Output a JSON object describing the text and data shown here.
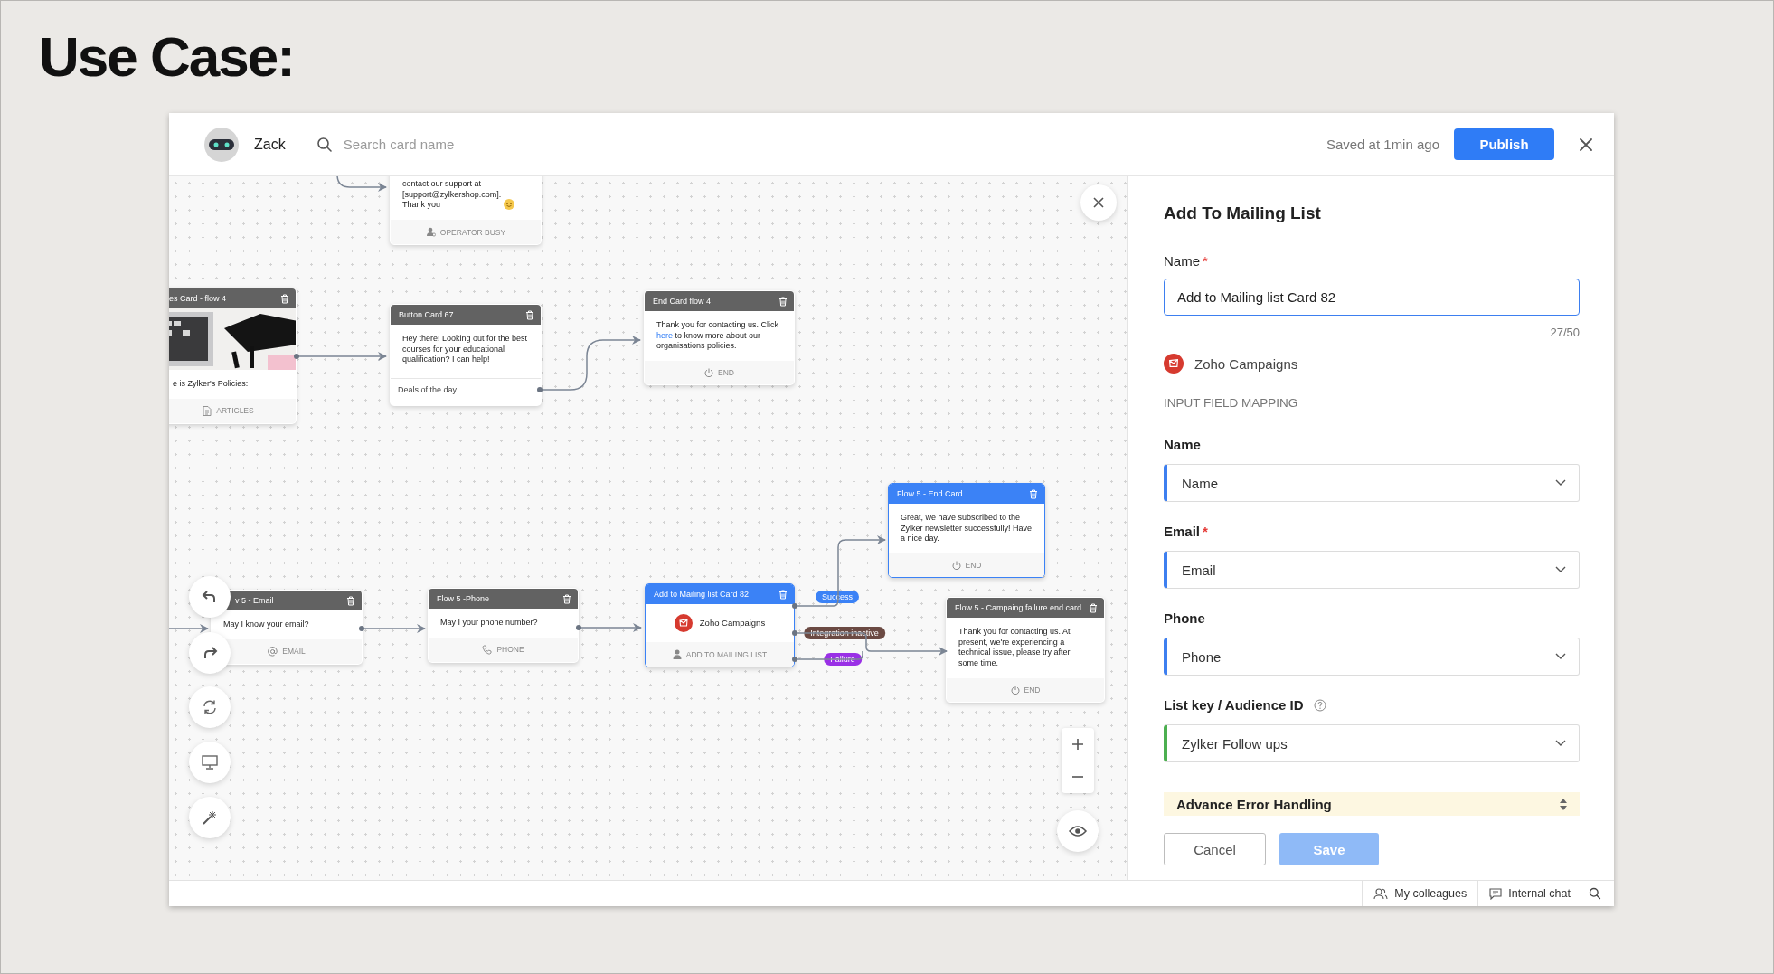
{
  "page_title": "Use Case:",
  "header": {
    "bot_name": "Zack",
    "search": {
      "placeholder": "Search card name"
    },
    "save_status": "Saved at 1min ago",
    "publish_button": "Publish"
  },
  "canvas": {
    "cards": [
      {
        "kind": "busy",
        "body": "contact our support at\n[support@zylkershop.com].\nThank you",
        "footer": {
          "kind": "operator",
          "label": "OPERATOR BUSY"
        },
        "highlighted": false
      },
      {
        "kind": "articles",
        "title": "es Card - flow 4",
        "body": "e is Zylker's Policies:",
        "footer": {
          "kind": "document",
          "label": "ARTICLES"
        },
        "highlighted": false
      },
      {
        "kind": "buttons",
        "title": "Button Card 67",
        "body": "Hey there! Looking out for the best courses for your educational qualification? I can help!",
        "option": "Deals of the day",
        "highlighted": false
      },
      {
        "kind": "message",
        "title": "End Card flow 4",
        "body": "Thank you for contacting us. Click ",
        "link": "here",
        "body_after": " to know more about our organisations policies.",
        "footer": {
          "kind": "end",
          "label": "END"
        },
        "highlighted": false
      },
      {
        "kind": "message",
        "title": "v 5 - Email",
        "body": "May I know your email?",
        "footer": {
          "kind": "email",
          "label": "EMAIL"
        },
        "highlighted": false
      },
      {
        "kind": "message",
        "title": "Flow 5 -Phone",
        "body": "May I your phone number?",
        "footer": {
          "kind": "phone",
          "label": "PHONE"
        },
        "highlighted": false
      },
      {
        "kind": "integration",
        "title": "Add to Mailing list Card 82",
        "service": "Zoho Campaigns",
        "footer": {
          "kind": "contact",
          "label": "ADD TO MAILING LIST"
        },
        "highlighted": true
      },
      {
        "kind": "message",
        "title": "Flow 5 - End Card",
        "body": "Great, we have subscribed to the Zylker newsletter successfully! Have a nice day.",
        "footer": {
          "kind": "end",
          "label": "END"
        },
        "highlighted": true
      },
      {
        "kind": "message",
        "title": "Flow 5 - Campaing failure end card",
        "body": "Thank you for contacting us. At present, we're experiencing a technical issue, please try after some time.",
        "footer": {
          "kind": "end",
          "label": "END"
        },
        "highlighted": false
      }
    ],
    "edge_labels": [
      {
        "text": "Success",
        "color": "#3b82f6"
      },
      {
        "text": "Integration inactive",
        "color": "#6b4a43"
      },
      {
        "text": "Failure",
        "color": "#9a30e6"
      }
    ]
  },
  "panel": {
    "title": "Add To Mailing List",
    "name_field": {
      "label": "Name",
      "required_mark": "*",
      "value": "Add to Mailing list Card 82",
      "counter": "27/50"
    },
    "integration": "Zoho Campaigns",
    "section_label": "INPUT FIELD MAPPING",
    "mappings": [
      {
        "label": "Name",
        "value": "Name",
        "help": false,
        "color": "#3d7ff0"
      },
      {
        "label": "Email",
        "required_mark": "*",
        "value": "Email",
        "help": false,
        "color": "#3d7ff0"
      },
      {
        "label": "Phone",
        "value": "Phone",
        "help": false,
        "color": "#3d7ff0"
      },
      {
        "label": "List key / Audience ID",
        "value": "Zylker Follow ups",
        "help": true,
        "color": "#4caf50"
      }
    ],
    "advanced": "Advance Error Handling",
    "buttons": [
      {
        "label": "Cancel",
        "kind": "secondary",
        "disabled": false
      },
      {
        "label": "Save",
        "kind": "primary",
        "disabled": true
      }
    ]
  },
  "status_bar": {
    "items": [
      {
        "kind": "people",
        "label": "My colleagues"
      },
      {
        "kind": "chat",
        "label": "Internal chat"
      }
    ]
  }
}
